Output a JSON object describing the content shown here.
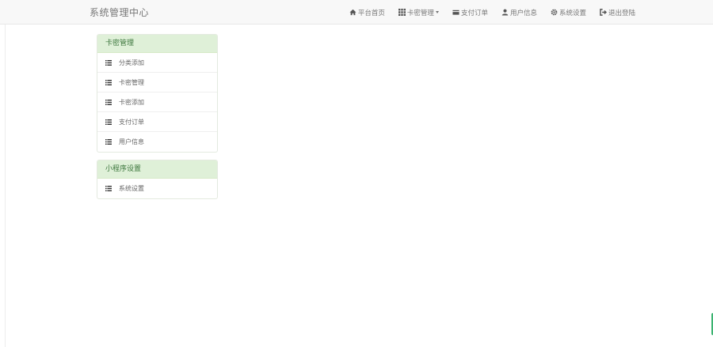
{
  "brand": "系统管理中心",
  "nav": [
    {
      "label": "平台首页",
      "icon": "home-icon"
    },
    {
      "label": "卡密管理",
      "icon": "grid-icon",
      "dropdown": true
    },
    {
      "label": "支付订单",
      "icon": "card-icon"
    },
    {
      "label": "用户信息",
      "icon": "user-icon"
    },
    {
      "label": "系统设置",
      "icon": "gear-icon"
    },
    {
      "label": "退出登陆",
      "icon": "logout-icon"
    }
  ],
  "panels": [
    {
      "title": "卡密管理",
      "items": [
        {
          "label": "分类添加",
          "icon": "list-icon"
        },
        {
          "label": "卡密管理",
          "icon": "list-icon"
        },
        {
          "label": "卡密添加",
          "icon": "list-icon"
        },
        {
          "label": "支付订单",
          "icon": "list-icon"
        },
        {
          "label": "用户信息",
          "icon": "list-icon"
        }
      ]
    },
    {
      "title": "小程序设置",
      "items": [
        {
          "label": "系统设置",
          "icon": "list-icon"
        }
      ]
    }
  ],
  "colors": {
    "navbar_bg": "#f8f8f8",
    "panel_heading_bg": "#dff0d8",
    "panel_heading_text": "#3c763d",
    "accent": "#3cb371"
  }
}
